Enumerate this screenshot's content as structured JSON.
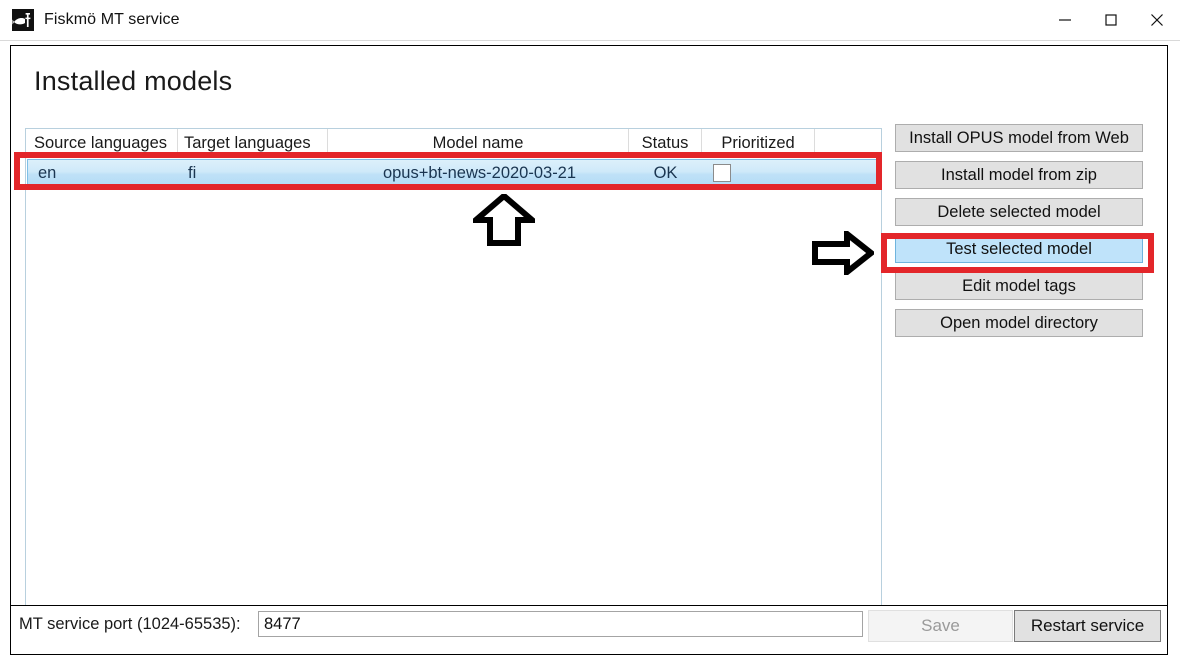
{
  "window": {
    "title": "Fiskmö MT service",
    "icon": "fish-f-logo-icon",
    "controls": {
      "minimize": "minimize-icon",
      "maximize": "maximize-icon",
      "close": "close-icon"
    }
  },
  "page": {
    "heading": "Installed models"
  },
  "models_table": {
    "columns": [
      "Source languages",
      "Target languages",
      "Model name",
      "Status",
      "Prioritized",
      ""
    ],
    "rows": [
      {
        "source_languages": "en",
        "target_languages": "fi",
        "model_name": "opus+bt-news-2020-03-21",
        "status": "OK",
        "prioritized": false,
        "selected": true
      }
    ]
  },
  "side_buttons": [
    {
      "label": "Install OPUS model from Web",
      "highlighted": false
    },
    {
      "label": "Install model from zip",
      "highlighted": false
    },
    {
      "label": "Delete selected model",
      "highlighted": false
    },
    {
      "label": "Test selected model",
      "highlighted": true
    },
    {
      "label": "Edit model tags",
      "highlighted": false
    },
    {
      "label": "Open model directory",
      "highlighted": false
    }
  ],
  "bottom_bar": {
    "port_label": "MT service port (1024-65535):",
    "port_value": "8477",
    "port_placeholder": "",
    "save_label": "Save",
    "save_enabled": false,
    "restart_label": "Restart service",
    "restart_enabled": true
  },
  "annotations": {
    "highlight_color": "#e3262a",
    "row_box": "selected-model-row",
    "button_box": "test-selected-model-button",
    "arrow_up": "up-arrow-annotation",
    "arrow_right": "right-arrow-annotation"
  }
}
